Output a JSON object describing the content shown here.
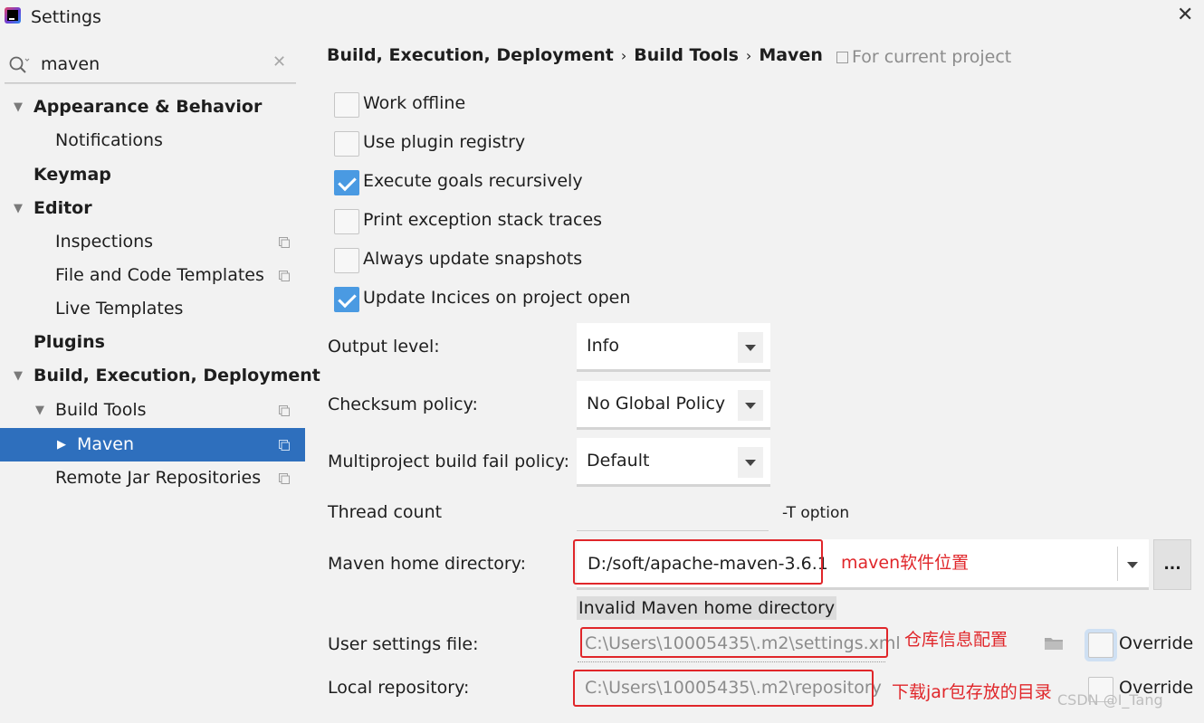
{
  "window": {
    "title": "Settings"
  },
  "search": {
    "value": "maven"
  },
  "sidebar": {
    "items": [
      {
        "label": "Appearance & Behavior"
      },
      {
        "label": "Notifications"
      },
      {
        "label": "Keymap"
      },
      {
        "label": "Editor"
      },
      {
        "label": "Inspections"
      },
      {
        "label": "File and Code Templates"
      },
      {
        "label": "Live Templates"
      },
      {
        "label": "Plugins"
      },
      {
        "label": "Build, Execution, Deployment"
      },
      {
        "label": "Build Tools"
      },
      {
        "label": "Maven"
      },
      {
        "label": "Remote Jar Repositories"
      }
    ]
  },
  "breadcrumb": {
    "part1": "Build, Execution, Deployment",
    "part2": "Build Tools",
    "part3": "Maven",
    "sep": "›"
  },
  "scope_label": "For current project",
  "options": [
    {
      "label": "Work offline",
      "checked": false
    },
    {
      "label": "Use plugin registry",
      "checked": false
    },
    {
      "label": "Execute goals recursively",
      "checked": true
    },
    {
      "label": "Print exception stack traces",
      "checked": false
    },
    {
      "label": "Always update snapshots",
      "checked": false
    },
    {
      "label": "Update Incices on project open",
      "checked": true
    }
  ],
  "fields": {
    "output_level": {
      "label": "Output level:",
      "value": "Info"
    },
    "checksum_policy": {
      "label": "Checksum policy:",
      "value": "No Global Policy"
    },
    "multiproject_policy": {
      "label": "Multiproject build fail policy:",
      "value": "Default"
    },
    "thread_count": {
      "label": "Thread count",
      "value": "",
      "hint": "-T option"
    },
    "maven_home": {
      "label": "Maven home directory:",
      "value": "D:/soft/apache-maven-3.6.1",
      "browse": "...",
      "error": "Invalid Maven home directory"
    },
    "user_settings": {
      "label": "User settings file:",
      "value": "C:\\Users\\10005435\\.m2\\settings.xml",
      "override": "Override"
    },
    "local_repository": {
      "label": "Local repository:",
      "value": "C:\\Users\\10005435\\.m2\\repository",
      "override": "Override"
    }
  },
  "annotations": {
    "maven_home": "maven软件位置",
    "user_settings": "仓库信息配置",
    "local_repository": "下载jar包存放的目录"
  },
  "watermark": "CSDN @I_Tang",
  "colors": {
    "selection": "#2e6fbd",
    "checkbox": "#4a9ae2",
    "annotation": "#e0262a"
  }
}
